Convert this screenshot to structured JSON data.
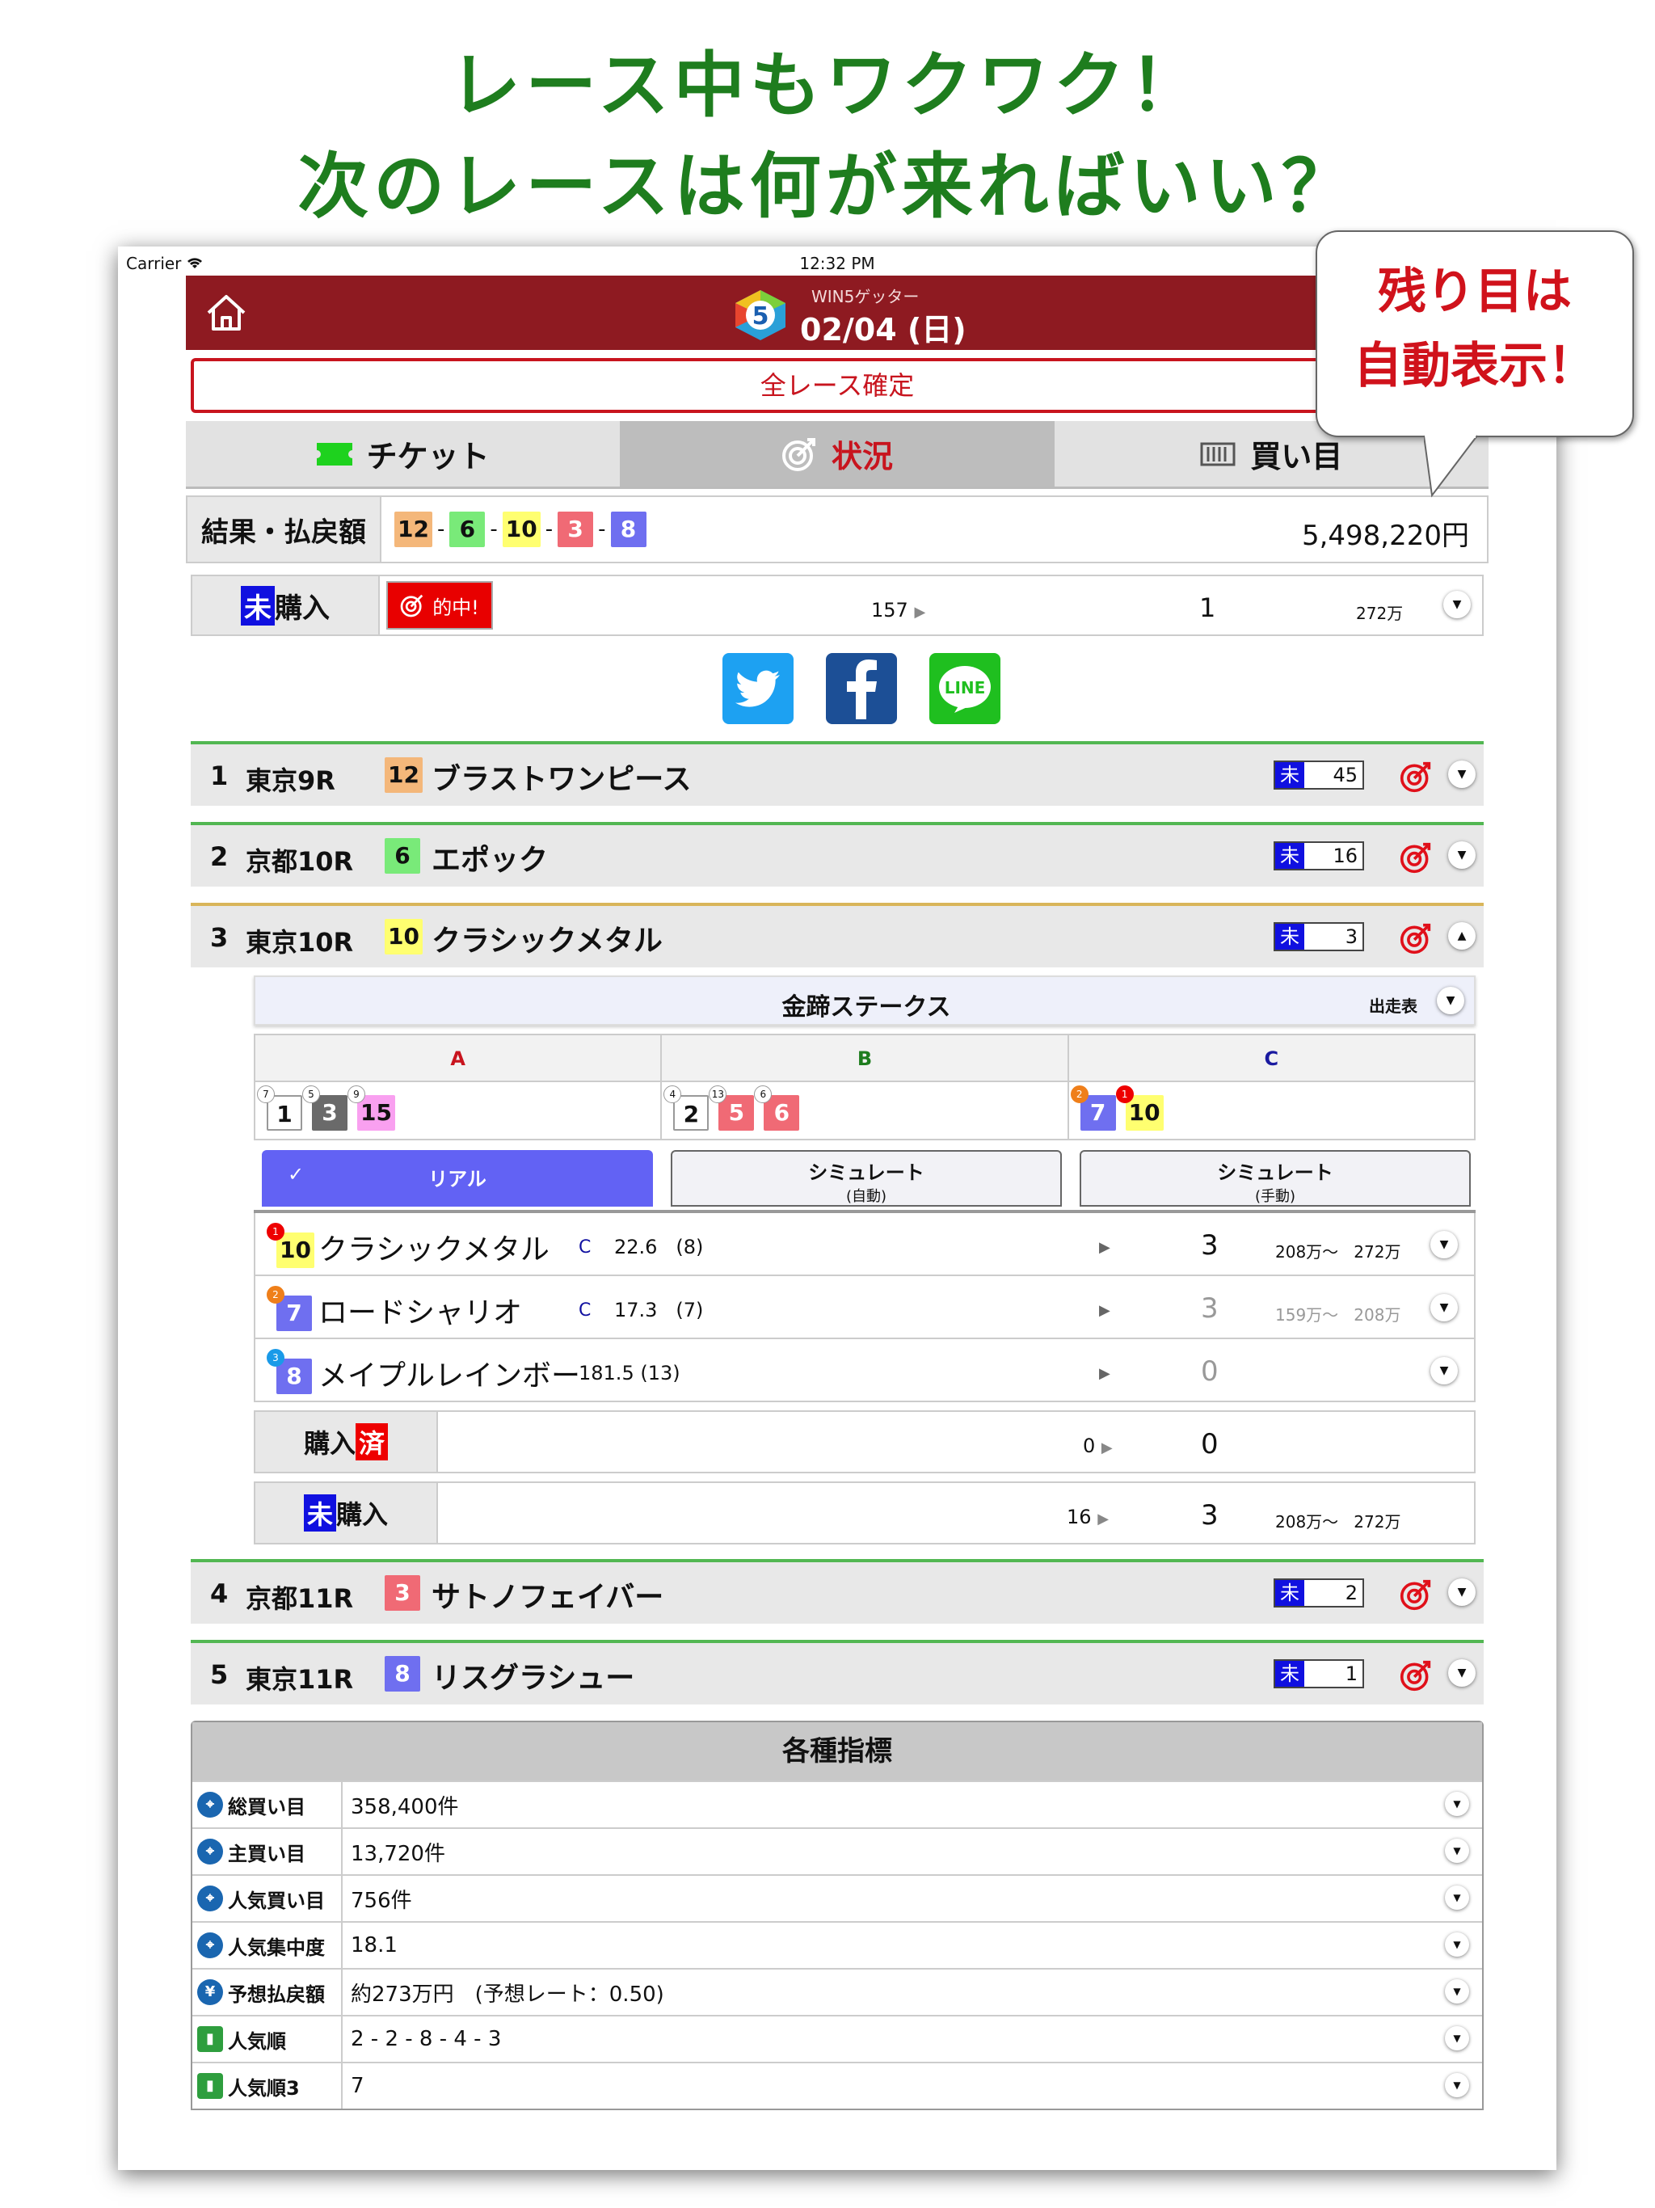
{
  "headline": {
    "line1": "レース中もワクワク！",
    "line2": "次のレースは何が来ればいい？"
  },
  "callout": {
    "line1": "残り目は",
    "line2": "自動表示！"
  },
  "statusbar": {
    "carrier": "Carrier",
    "time": "12:32 PM"
  },
  "header": {
    "app_name": "WIN5ゲッター",
    "date": "02/04 (日)"
  },
  "confirm_label": "全レース確定",
  "tabs": [
    {
      "label": "チケット",
      "icon": "ticket-icon"
    },
    {
      "label": "状況",
      "icon": "target-icon",
      "active": true
    },
    {
      "label": "買い目",
      "icon": "list-icon"
    }
  ],
  "result": {
    "label": "結果・払戻額",
    "numbers": [
      "12",
      "6",
      "10",
      "3",
      "8"
    ],
    "sep": "-",
    "payout": "5,498,220円"
  },
  "unpurchased": {
    "mi": "未",
    "label": "購入",
    "hit": "的中!",
    "count": "157",
    "value": "1",
    "amount": "272万"
  },
  "social": [
    "twitter",
    "facebook",
    "line"
  ],
  "races": [
    {
      "no": "1",
      "venue": "東京9R",
      "horse_no": "12",
      "horse": "ブラストワンピース",
      "mi": "未",
      "count": "45"
    },
    {
      "no": "2",
      "venue": "京都10R",
      "horse_no": "6",
      "horse": "エポック",
      "mi": "未",
      "count": "16"
    },
    {
      "no": "3",
      "venue": "東京10R",
      "horse_no": "10",
      "horse": "クラシックメタル",
      "mi": "未",
      "count": "3"
    },
    {
      "no": "4",
      "venue": "京都11R",
      "horse_no": "3",
      "horse": "サトノフェイバー",
      "mi": "未",
      "count": "2"
    },
    {
      "no": "5",
      "venue": "東京11R",
      "horse_no": "8",
      "horse": "リスグラシュー",
      "mi": "未",
      "count": "1"
    }
  ],
  "detail": {
    "race_name": "金蹄ステークス",
    "entry_label": "出走表",
    "groups": [
      {
        "label": "A",
        "color": "#c8141e",
        "horses": [
          {
            "pop": "7",
            "no": "1"
          },
          {
            "pop": "5",
            "no": "3"
          },
          {
            "pop": "9",
            "no": "15"
          }
        ]
      },
      {
        "label": "B",
        "color": "#1e7d1e",
        "horses": [
          {
            "pop": "4",
            "no": "2"
          },
          {
            "pop": "13",
            "no": "5"
          },
          {
            "pop": "6",
            "no": "6"
          }
        ]
      },
      {
        "label": "C",
        "color": "#1a1aa0",
        "horses": [
          {
            "pop": "2",
            "no": "7"
          },
          {
            "pop": "1",
            "no": "10"
          }
        ]
      }
    ],
    "modes": {
      "real": "リアル",
      "sim_auto": "シミュレート",
      "sim_auto_sub": "(自動)",
      "sim_manual": "シミュレート",
      "sim_manual_sub": "(手動)"
    },
    "horses": [
      {
        "pop": "1",
        "no": "10",
        "name": "クラシックメタル",
        "mark": "C",
        "odds": "22.6",
        "rank": "(8)",
        "value": "3",
        "range_from": "208万～",
        "range_to": "272万"
      },
      {
        "pop": "2",
        "no": "7",
        "name": "ロードシャリオ",
        "mark": "C",
        "odds": "17.3",
        "rank": "(7)",
        "value": "3",
        "range_from": "159万～",
        "range_to": "208万"
      },
      {
        "pop": "3",
        "no": "8",
        "name": "メイプルレインボー",
        "mark": "",
        "odds": "181.5",
        "rank": "(13)",
        "value": "0",
        "range_from": "",
        "range_to": ""
      }
    ],
    "purchased": {
      "label": "購入",
      "sumi": "済",
      "count": "0",
      "value": "0"
    },
    "unpurchased": {
      "mi": "未",
      "label": "購入",
      "count": "16",
      "value": "3",
      "range_from": "208万～",
      "range_to": "272万"
    }
  },
  "metrics": {
    "title": "各種指標",
    "rows": [
      {
        "label": "総買い目",
        "value": "358,400件",
        "icon": "crosshair-icon"
      },
      {
        "label": "主買い目",
        "value": "13,720件",
        "icon": "crosshair-icon"
      },
      {
        "label": "人気買い目",
        "value": "756件",
        "icon": "crosshair-icon"
      },
      {
        "label": "人気集中度",
        "value": "18.1",
        "icon": "crosshair-icon"
      },
      {
        "label": "予想払戻額",
        "value": "約273万円　(予想レート：0.50)",
        "icon": "yen-icon"
      },
      {
        "label": "人気順",
        "value": "2 - 2 - 8 - 4 - 3",
        "icon": "ranking-icon"
      },
      {
        "label": "人気順3",
        "value": "7",
        "icon": "ranking-icon"
      }
    ]
  },
  "colors": {
    "accent": "#8e1a21",
    "headline": "#1e7d1e",
    "callout": "#d0121b",
    "race_border": "#52b752"
  }
}
